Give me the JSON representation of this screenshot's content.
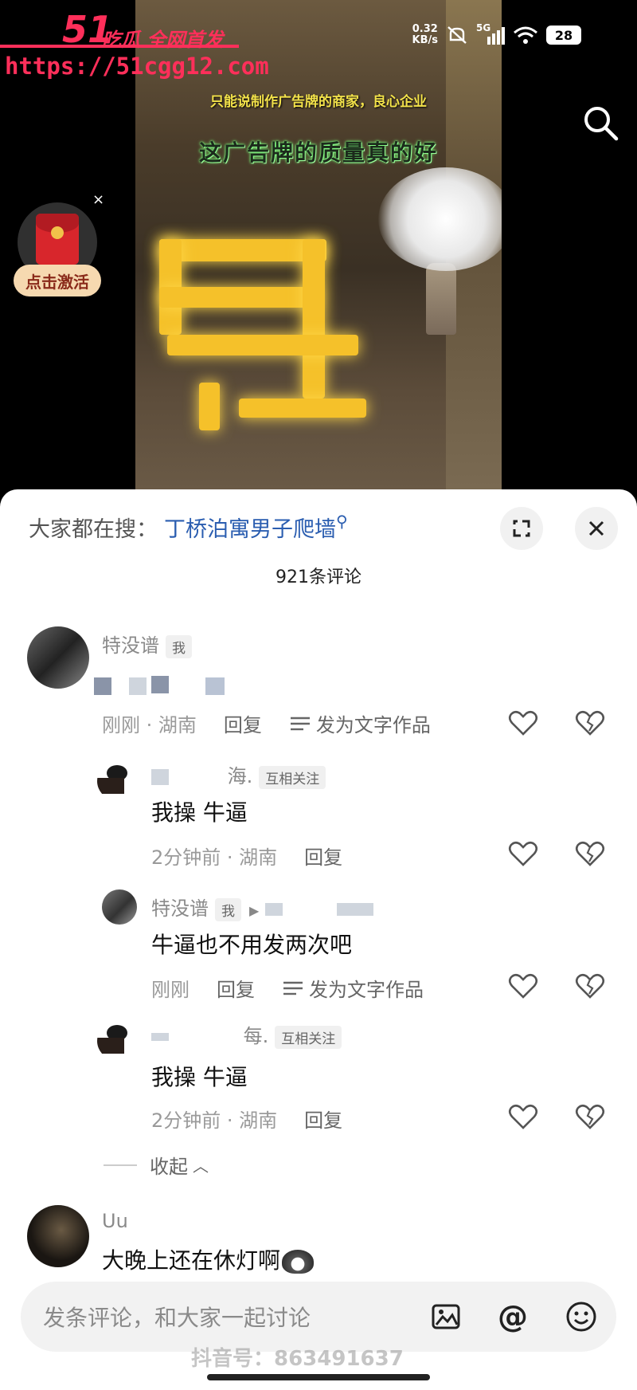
{
  "watermark": {
    "brand": "51",
    "tag": "吃瓜 全网首发",
    "url": "https://51cgg12.com"
  },
  "status_bar": {
    "net_speed": "0.32",
    "net_unit": "KB/s",
    "signal": "5G",
    "battery": "28"
  },
  "video": {
    "caption_small": "只能说制作广告牌的商家，良心企业",
    "caption_big": "这广告牌的质量真的好"
  },
  "red_packet": {
    "label": "点击激活",
    "close": "×"
  },
  "sheet": {
    "hot_label": "大家都在搜：",
    "hot_query": "丁桥泊寓男子爬墙",
    "comment_count": "921条评论",
    "comments": [
      {
        "username": "特没谱",
        "tag": "我",
        "time": "刚刚 · 湖南",
        "reply": "回复",
        "post_label": "发为文字作品"
      },
      {
        "username_suffix": "海.",
        "tag": "互相关注",
        "body": "我操 牛逼",
        "time": "2分钟前 · 湖南",
        "reply": "回复"
      },
      {
        "username": "特没谱",
        "tag": "我",
        "body": "牛逼也不用发两次吧",
        "time": "刚刚",
        "reply": "回复",
        "post_label": "发为文字作品"
      },
      {
        "username_suffix": "每.",
        "tag": "互相关注",
        "body": "我操 牛逼",
        "time": "2分钟前 · 湖南",
        "reply": "回复"
      },
      {
        "username": "Uu",
        "body": "大晚上还在休灯啊"
      }
    ],
    "collapse_label": "收起"
  },
  "input": {
    "placeholder": "发条评论，和大家一起讨论"
  },
  "douyin_watermark": "抖音号：863491637",
  "colors": {
    "watermark": "#ff2f5a",
    "link": "#2a5db0",
    "sign": "#f5c12a"
  }
}
